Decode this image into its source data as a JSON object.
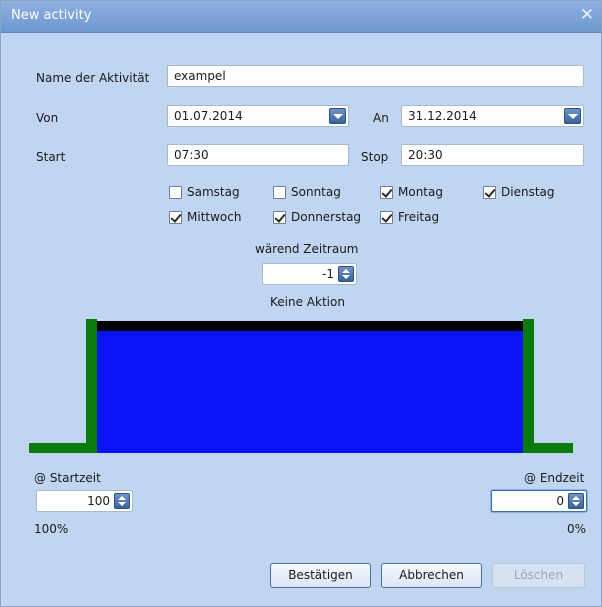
{
  "window": {
    "title": "New activity",
    "close_label": "✕"
  },
  "form": {
    "name_label": "Name der Aktivität",
    "name_value": "exampel",
    "von_label": "Von",
    "von_value": "01.07.2014",
    "an_label": "An",
    "an_value": "31.12.2014",
    "start_label": "Start",
    "start_value": "07:30",
    "stop_label": "Stop",
    "stop_value": "20:30"
  },
  "days": [
    {
      "label": "Samstag",
      "checked": false
    },
    {
      "label": "Sonntag",
      "checked": false
    },
    {
      "label": "Montag",
      "checked": true
    },
    {
      "label": "Dienstag",
      "checked": true
    },
    {
      "label": "Mittwoch",
      "checked": true
    },
    {
      "label": "Donnerstag",
      "checked": true
    },
    {
      "label": "Freitag",
      "checked": true
    }
  ],
  "period": {
    "label": "wärend Zeitraum",
    "value": "-1",
    "action_text": "Keine Aktion"
  },
  "start_time": {
    "label": "@ Startzeit",
    "value": "100",
    "percent": "100%"
  },
  "end_time": {
    "label": "@ Endzeit",
    "value": "0",
    "percent": "0%"
  },
  "buttons": {
    "confirm": "Bestätigen",
    "cancel": "Abbrechen",
    "delete": "Löschen"
  },
  "colors": {
    "level_fill": "#0a14f5",
    "outline": "#0a7a0a",
    "top_bar": "#000000"
  }
}
